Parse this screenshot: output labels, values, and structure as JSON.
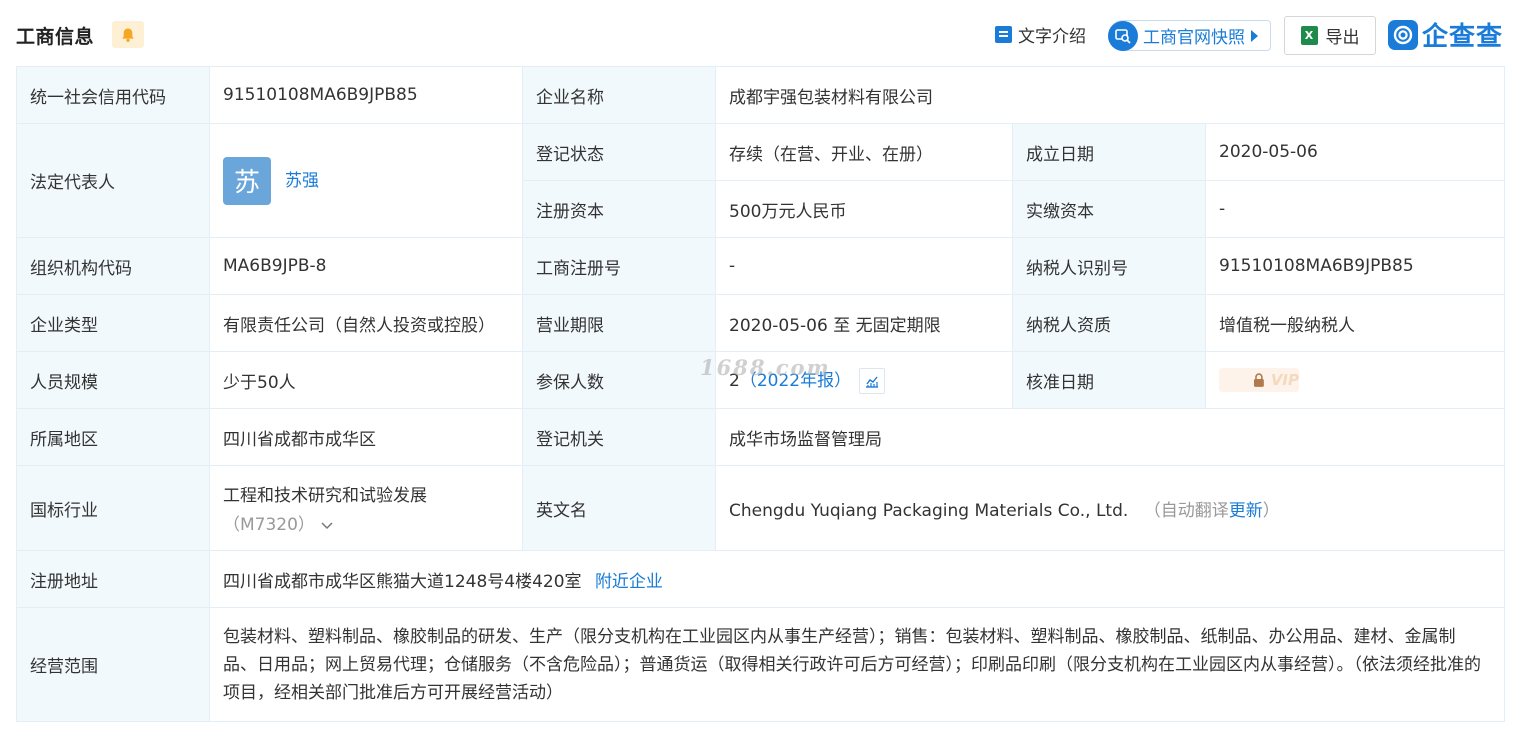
{
  "header": {
    "title": "工商信息",
    "text_intro": "文字介绍",
    "snapshot": "工商官网快照",
    "export": "导出",
    "export_icon_text": "X",
    "brand": "企查查"
  },
  "colors": {
    "accent": "#1a7cd8",
    "label_bg": "#f2f9fc",
    "border": "#e4eef6"
  },
  "watermark": "1688.com",
  "rows": {
    "credit_code": {
      "label": "统一社会信用代码",
      "value": "91510108MA6B9JPB85"
    },
    "company_name": {
      "label": "企业名称",
      "value": "成都宇强包装材料有限公司"
    },
    "legal_rep": {
      "label": "法定代表人",
      "avatar": "苏",
      "name": "苏强"
    },
    "reg_status": {
      "label": "登记状态",
      "value": "存续（在营、开业、在册）"
    },
    "found_date": {
      "label": "成立日期",
      "value": "2020-05-06"
    },
    "reg_capital": {
      "label": "注册资本",
      "value": "500万元人民币"
    },
    "paid_capital": {
      "label": "实缴资本",
      "value": "-"
    },
    "org_code": {
      "label": "组织机构代码",
      "value": "MA6B9JPB-8"
    },
    "reg_no": {
      "label": "工商注册号",
      "value": "-"
    },
    "tax_id": {
      "label": "纳税人识别号",
      "value": "91510108MA6B9JPB85"
    },
    "company_type": {
      "label": "企业类型",
      "value": "有限责任公司（自然人投资或控股）"
    },
    "business_term": {
      "label": "营业期限",
      "value": "2020-05-06 至 无固定期限"
    },
    "tax_qualification": {
      "label": "纳税人资质",
      "value": "增值税一般纳税人"
    },
    "staff_size": {
      "label": "人员规模",
      "value": "少于50人"
    },
    "insured": {
      "label": "参保人数",
      "value": "2",
      "report": "（2022年报）"
    },
    "approval_date": {
      "label": "核准日期",
      "vip": "VIP"
    },
    "region": {
      "label": "所属地区",
      "value": "四川省成都市成华区"
    },
    "reg_authority": {
      "label": "登记机关",
      "value": "成华市场监督管理局"
    },
    "industry": {
      "label": "国标行业",
      "value": "工程和技术研究和试验发展",
      "code": "（M7320）"
    },
    "english_name": {
      "label": "英文名",
      "value": "Chengdu Yuqiang Packaging Materials Co., Ltd.",
      "auto_prefix": "（自动翻译",
      "update": "更新",
      "auto_suffix": "）"
    },
    "address": {
      "label": "注册地址",
      "value": "四川省成都市成华区熊猫大道1248号4楼420室",
      "nearby": "附近企业"
    },
    "scope": {
      "label": "经营范围",
      "value": "包装材料、塑料制品、橡胶制品的研发、生产（限分支机构在工业园区内从事生产经营）；销售：包装材料、塑料制品、橡胶制品、纸制品、办公用品、建材、金属制品、日用品；网上贸易代理；仓储服务（不含危险品）；普通货运（取得相关行政许可后方可经营）；印刷品印刷（限分支机构在工业园区内从事经营）。（依法须经批准的项目，经相关部门批准后方可开展经营活动）"
    }
  }
}
